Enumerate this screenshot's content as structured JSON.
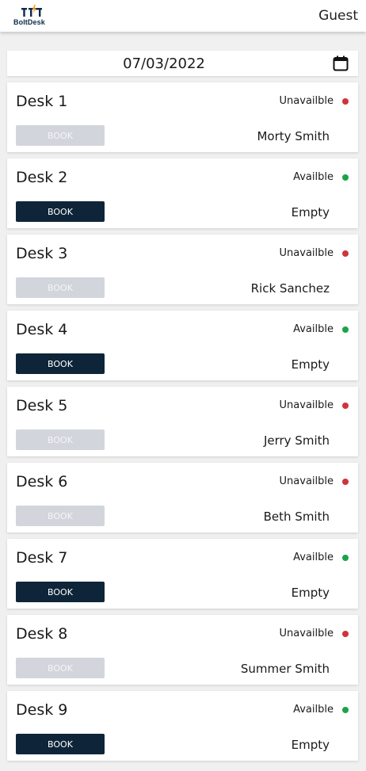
{
  "header": {
    "logo_text": "BoltDesk",
    "user": "Guest"
  },
  "date_picker": {
    "value": "07/03/2022",
    "icon": "calendar-icon"
  },
  "colors": {
    "available": "#1aa34a",
    "unavailable": "#d1323c",
    "book_enabled_bg": "#0e2539",
    "book_enabled_text": "#ffffff",
    "book_disabled_bg": "#d2d5dc",
    "book_disabled_text": "#f4f5f7"
  },
  "desks": [
    {
      "name": "Desk 1",
      "status": "Unavailble",
      "available": false,
      "book_label": "BOOK",
      "occupant": "Morty Smith"
    },
    {
      "name": "Desk 2",
      "status": "Availble",
      "available": true,
      "book_label": "BOOK",
      "occupant": "Empty"
    },
    {
      "name": "Desk 3",
      "status": "Unavailble",
      "available": false,
      "book_label": "BOOK",
      "occupant": "Rick Sanchez"
    },
    {
      "name": "Desk 4",
      "status": "Availble",
      "available": true,
      "book_label": "BOOK",
      "occupant": "Empty"
    },
    {
      "name": "Desk 5",
      "status": "Unavailble",
      "available": false,
      "book_label": "BOOK",
      "occupant": "Jerry Smith"
    },
    {
      "name": "Desk 6",
      "status": "Unavailble",
      "available": false,
      "book_label": "BOOK",
      "occupant": "Beth Smith"
    },
    {
      "name": "Desk 7",
      "status": "Availble",
      "available": true,
      "book_label": "BOOK",
      "occupant": "Empty"
    },
    {
      "name": "Desk 8",
      "status": "Unavailble",
      "available": false,
      "book_label": "BOOK",
      "occupant": "Summer Smith"
    },
    {
      "name": "Desk 9",
      "status": "Availble",
      "available": true,
      "book_label": "BOOK",
      "occupant": "Empty"
    }
  ]
}
